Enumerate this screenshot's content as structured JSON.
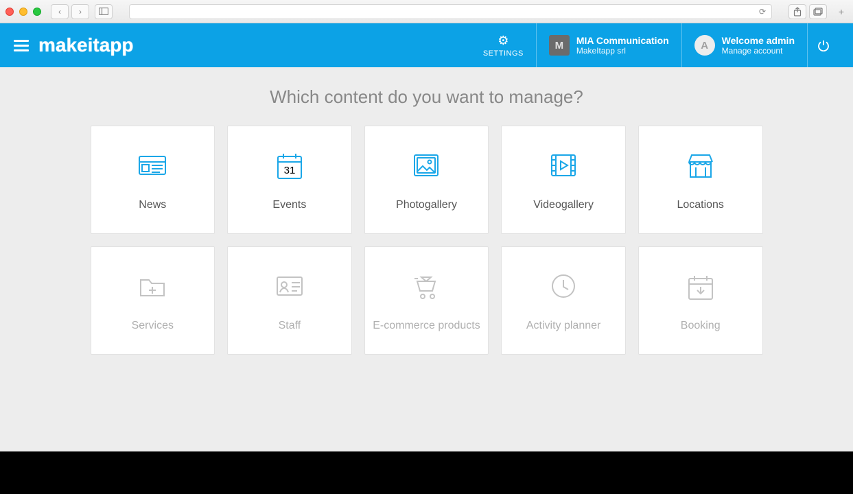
{
  "header": {
    "logo": "makeitapp",
    "settings_label": "SETTINGS",
    "org": {
      "initial": "M",
      "name": "MIA Communication",
      "sub": "MakeItapp srl"
    },
    "user": {
      "initial": "A",
      "welcome": "Welcome admin",
      "manage": "Manage account"
    }
  },
  "page": {
    "title": "Which content do you want to manage?"
  },
  "cards": [
    {
      "id": "news",
      "label": "News",
      "icon": "news",
      "faded": false
    },
    {
      "id": "events",
      "label": "Events",
      "icon": "calendar",
      "faded": false
    },
    {
      "id": "photo",
      "label": "Photogallery",
      "icon": "photo",
      "faded": false
    },
    {
      "id": "video",
      "label": "Videogallery",
      "icon": "video",
      "faded": false
    },
    {
      "id": "locations",
      "label": "Locations",
      "icon": "store",
      "faded": false
    },
    {
      "id": "services",
      "label": "Services",
      "icon": "folder-plus",
      "faded": true
    },
    {
      "id": "staff",
      "label": "Staff",
      "icon": "id-card",
      "faded": true
    },
    {
      "id": "ecommerce",
      "label": "E-commerce products",
      "icon": "cart",
      "faded": true
    },
    {
      "id": "planner",
      "label": "Activity planner",
      "icon": "clock",
      "faded": true
    },
    {
      "id": "booking",
      "label": "Booking",
      "icon": "cal-down",
      "faded": true
    }
  ]
}
